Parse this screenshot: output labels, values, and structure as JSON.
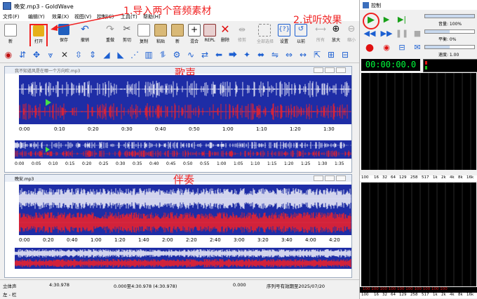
{
  "window": {
    "title": "晚安.mp3 - GoldWave"
  },
  "menu": [
    "文件(F)",
    "编辑(Y)",
    "效果(X)",
    "视图(V)",
    "控制(C)",
    "工具(T)",
    "帮助(H)"
  ],
  "toolbar": [
    {
      "label": "新",
      "icon": "new-file-icon"
    },
    {
      "label": "打开",
      "icon": "open-folder-icon"
    },
    {
      "label": "保存",
      "icon": "save-icon"
    },
    {
      "label": "撤销",
      "icon": "undo-icon"
    },
    {
      "label": "重做",
      "icon": "redo-icon"
    },
    {
      "label": "剪切",
      "icon": "cut-icon"
    },
    {
      "label": "复制",
      "icon": "copy-icon"
    },
    {
      "label": "粘贴",
      "icon": "paste-icon"
    },
    {
      "label": "新",
      "icon": "paste-new-icon"
    },
    {
      "label": "混合",
      "icon": "mix-icon"
    },
    {
      "label": "REPL",
      "icon": "replace-icon"
    },
    {
      "label": "删除",
      "icon": "delete-icon"
    },
    {
      "label": "修剪",
      "icon": "trim-icon"
    },
    {
      "label": "全部选择",
      "icon": "select-all-icon"
    },
    {
      "label": "设置",
      "icon": "set-icon"
    },
    {
      "label": "以前",
      "icon": "previous-icon"
    },
    {
      "label": "所有",
      "icon": "all-icon"
    },
    {
      "label": "放大",
      "icon": "zoom-in-icon"
    },
    {
      "label": "缩小",
      "icon": "zoom-out-icon"
    }
  ],
  "annotations": {
    "step1": "1.导入两个音频素材",
    "step2": "2.试听效果",
    "vocal": "歌声",
    "accompaniment": "伴奏"
  },
  "doc1": {
    "title": "我不知道风是在哪一个方向吹.mp3",
    "ticks": [
      "0:00",
      "0:10",
      "0:20",
      "0:30",
      "0:40",
      "0:50",
      "1:00",
      "1:10",
      "1:20",
      "1:30"
    ],
    "overview_ticks": [
      "0:00",
      "0:05",
      "0:10",
      "0:15",
      "0:20",
      "0:25",
      "0:30",
      "0:35",
      "0:40",
      "0:45",
      "0:50",
      "0:55",
      "1:00",
      "1:05",
      "1:10",
      "1:15",
      "1:20",
      "1:25",
      "1:30",
      "1:35"
    ]
  },
  "doc2": {
    "title": "晚安.mp3",
    "ticks": [
      "0:00",
      "0:20",
      "0:40",
      "1:00",
      "1:20",
      "1:40",
      "2:00",
      "2:20",
      "2:40",
      "3:00",
      "3:20",
      "3:40",
      "4:00",
      "4:20"
    ]
  },
  "status": {
    "channel": "立体声",
    "length": "4:30.978",
    "selection": "0.000至4:30.978 (4:30.978)",
    "position": "0.000",
    "serial": "序列号有效期至2025/07/20",
    "bottom": "左 - 栏"
  },
  "control": {
    "title": "控制",
    "volume": "音量: 100%",
    "balance": "平衡: 0%",
    "speed": "速度: 1.00",
    "time": "00:00:00.0",
    "freq_labels": [
      "100",
      "16",
      "32",
      "64",
      "129",
      "258",
      "517",
      "1k",
      "2k",
      "4k",
      "8k",
      "16k"
    ],
    "volume_level": 1.0,
    "balance_level": 0.5,
    "speed_level": 0.5
  },
  "colors": {
    "wave_bg": "#1e2da6",
    "wave_left": "#ffffff",
    "wave_right": "#ff2020",
    "annotation": "#f02020"
  }
}
